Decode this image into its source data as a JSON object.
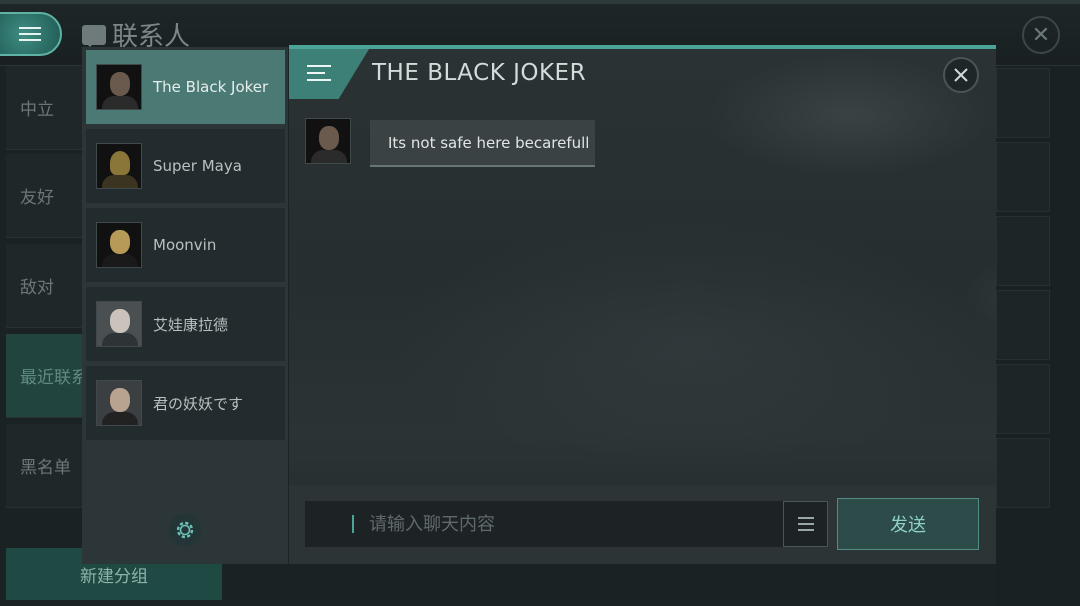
{
  "background": {
    "title": "联系人",
    "sidebar": [
      "中立",
      "友好",
      "敌对",
      "最近联系人",
      "黑名单"
    ],
    "active_index": 3,
    "new_group": "新建分组"
  },
  "contacts": [
    {
      "name": "The Black Joker",
      "selected": true
    },
    {
      "name": "Super Maya",
      "selected": false
    },
    {
      "name": "Moonvin",
      "selected": false
    },
    {
      "name": "艾娃康拉德",
      "selected": false
    },
    {
      "name": "君の妖妖です",
      "selected": false
    }
  ],
  "chat": {
    "title": "THE BLACK JOKER",
    "messages": [
      {
        "text": "Its not safe here becarefull"
      }
    ],
    "input_placeholder": "请输入聊天内容",
    "send_label": "发送"
  },
  "colors": {
    "accent": "#4aa497",
    "selected": "#4b7a74",
    "panel": "#2c3537"
  }
}
